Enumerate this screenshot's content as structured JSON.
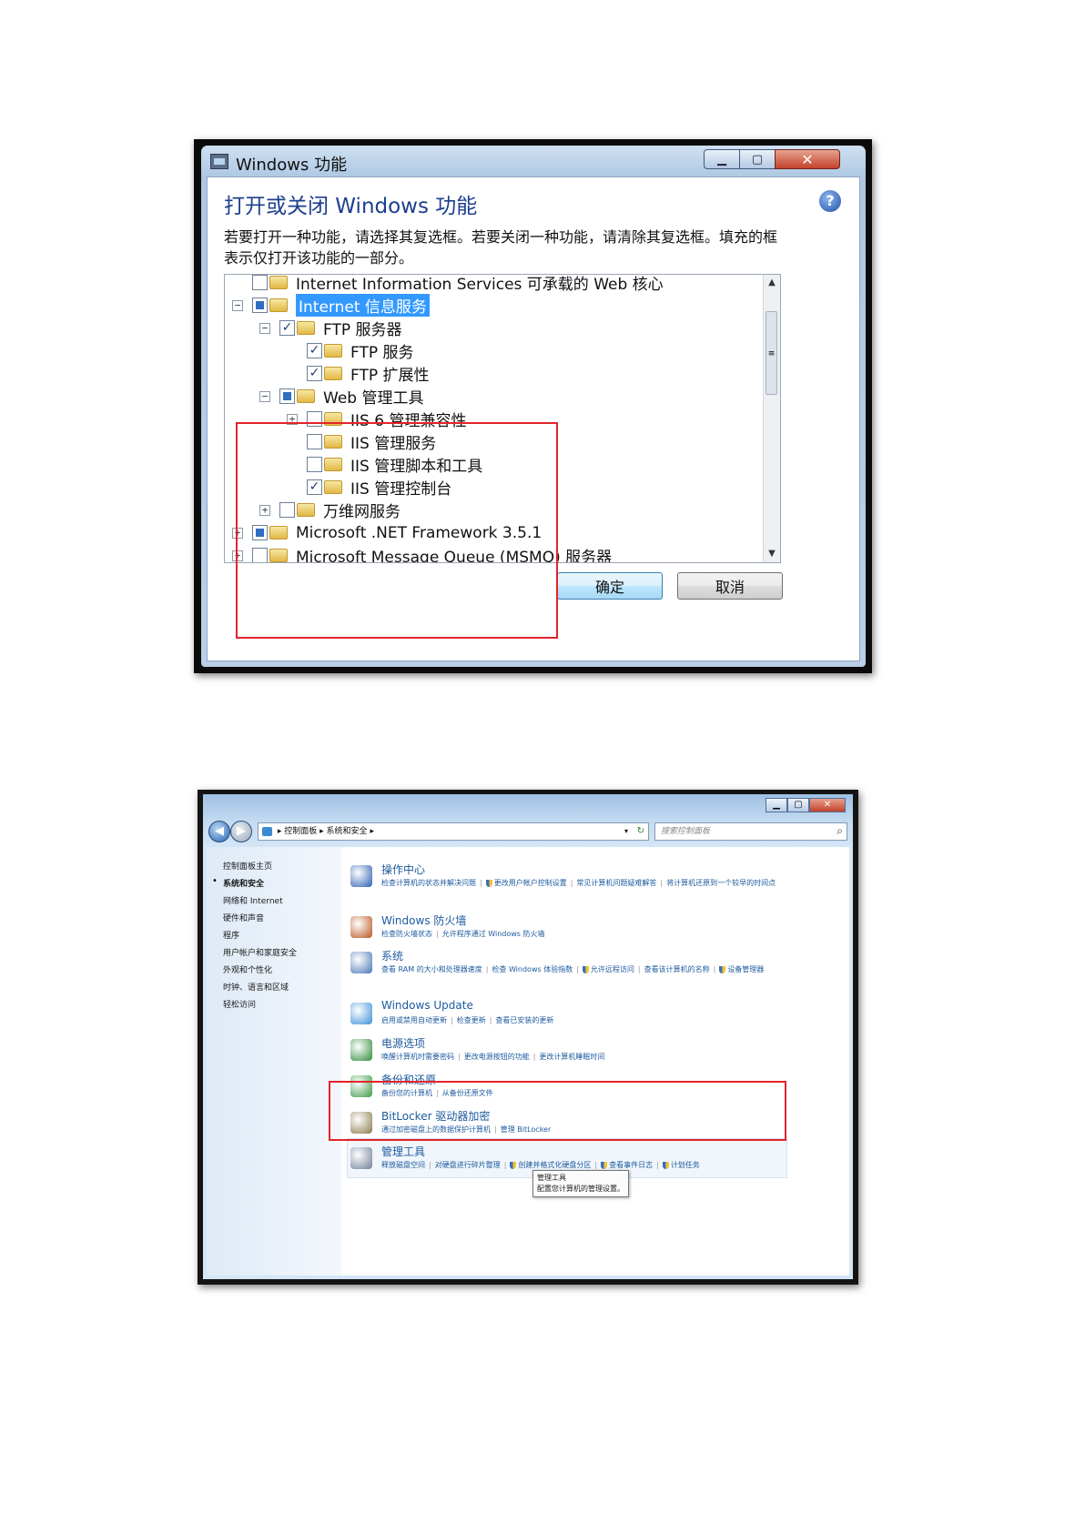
{
  "dialog": {
    "title": "Windows 功能",
    "heading": "打开或关闭 Windows 功能",
    "description": "若要打开一种功能，请选择其复选框。若要关闭一种功能，请清除其复选框。填充的框表示仅打开该功能的一部分。",
    "tree": [
      {
        "label": "Internet Information Services 可承载的 Web 核心",
        "level": 0,
        "expander": "none",
        "check": "unchecked"
      },
      {
        "label": "Internet 信息服务",
        "level": 0,
        "expander": "minus",
        "check": "partial",
        "selected": true
      },
      {
        "label": "FTP 服务器",
        "level": 1,
        "expander": "minus",
        "check": "checked"
      },
      {
        "label": "FTP 服务",
        "level": 2,
        "expander": "none",
        "check": "checked"
      },
      {
        "label": "FTP 扩展性",
        "level": 2,
        "expander": "none",
        "check": "checked"
      },
      {
        "label": "Web 管理工具",
        "level": 1,
        "expander": "minus",
        "check": "partial"
      },
      {
        "label": "IIS 6 管理兼容性",
        "level": 2,
        "expander": "plus",
        "check": "unchecked"
      },
      {
        "label": "IIS 管理服务",
        "level": 2,
        "expander": "none",
        "check": "unchecked"
      },
      {
        "label": "IIS 管理脚本和工具",
        "level": 2,
        "expander": "none",
        "check": "unchecked"
      },
      {
        "label": "IIS 管理控制台",
        "level": 2,
        "expander": "none",
        "check": "checked"
      },
      {
        "label": "万维网服务",
        "level": 1,
        "expander": "plus",
        "check": "unchecked"
      },
      {
        "label": "Microsoft .NET Framework 3.5.1",
        "level": 0,
        "expander": "plus",
        "check": "partial"
      },
      {
        "label": "Microsoft Message Queue (MSMQ) 服务器",
        "level": 0,
        "expander": "plus",
        "check": "unchecked"
      }
    ],
    "ok_label": "确定",
    "cancel_label": "取消",
    "icons": {
      "help": "help-icon",
      "folder": "folder-icon"
    },
    "annotation_color": "#e3242b"
  },
  "control_panel": {
    "breadcrumb": [
      "控制面板",
      "系统和安全"
    ],
    "search_placeholder": "搜索控制面板",
    "sidebar": [
      {
        "label": "控制面板主页",
        "current": false
      },
      {
        "label": "系统和安全",
        "current": true
      },
      {
        "label": "网络和 Internet",
        "current": false
      },
      {
        "label": "硬件和声音",
        "current": false
      },
      {
        "label": "程序",
        "current": false
      },
      {
        "label": "用户帐户和家庭安全",
        "current": false
      },
      {
        "label": "外观和个性化",
        "current": false
      },
      {
        "label": "时钟、语言和区域",
        "current": false
      },
      {
        "label": "轻松访问",
        "current": false
      }
    ],
    "categories": [
      {
        "title": "操作中心",
        "icon": "flag-icon",
        "color": "#2b5fb3",
        "links": [
          {
            "text": "检查计算机的状态并解决问题"
          },
          {
            "text": "更改用户帐户控制设置",
            "shield": true
          },
          {
            "text": "常见计算机问题疑难解答"
          },
          {
            "text": "将计算机还原到一个较早的时间点"
          }
        ]
      },
      {
        "title": "Windows 防火墙",
        "icon": "firewall-icon",
        "color": "#b8541f",
        "links": [
          {
            "text": "检查防火墙状态"
          },
          {
            "text": "允许程序通过 Windows 防火墙"
          }
        ]
      },
      {
        "title": "系统",
        "icon": "system-icon",
        "color": "#4a78b8",
        "links": [
          {
            "text": "查看 RAM 的大小和处理器速度"
          },
          {
            "text": "检查 Windows 体验指数"
          },
          {
            "text": "允许远程访问",
            "shield": true
          },
          {
            "text": "查看该计算机的名称"
          },
          {
            "text": "设备管理器",
            "shield": true
          }
        ]
      },
      {
        "title": "Windows Update",
        "icon": "windows-update-icon",
        "color": "#3c8fd6",
        "links": [
          {
            "text": "启用或禁用自动更新"
          },
          {
            "text": "检查更新"
          },
          {
            "text": "查看已安装的更新"
          }
        ]
      },
      {
        "title": "电源选项",
        "icon": "power-icon",
        "color": "#2f8d3a",
        "links": [
          {
            "text": "唤醒计算机时需要密码"
          },
          {
            "text": "更改电源按钮的功能"
          },
          {
            "text": "更改计算机睡眠时间"
          }
        ]
      },
      {
        "title": "备份和还原",
        "icon": "backup-icon",
        "color": "#3b9b46",
        "links": [
          {
            "text": "备份您的计算机"
          },
          {
            "text": "从备份还原文件"
          }
        ]
      },
      {
        "title": "BitLocker 驱动器加密",
        "icon": "bitlocker-icon",
        "color": "#8a7b4a",
        "links": [
          {
            "text": "通过加密磁盘上的数据保护计算机"
          },
          {
            "text": "管理 BitLocker"
          }
        ]
      },
      {
        "title": "管理工具",
        "icon": "admin-tools-icon",
        "color": "#6d7f96",
        "links": [
          {
            "text": "释放磁盘空间"
          },
          {
            "text": "对硬盘进行碎片整理"
          },
          {
            "text": "创建并格式化硬盘分区",
            "shield": true
          },
          {
            "text": "查看事件日志",
            "shield": true
          },
          {
            "text": "计划任务",
            "shield": true
          }
        ]
      }
    ],
    "tooltip": {
      "title": "管理工具",
      "text": "配置您计算机的管理设置。"
    }
  }
}
